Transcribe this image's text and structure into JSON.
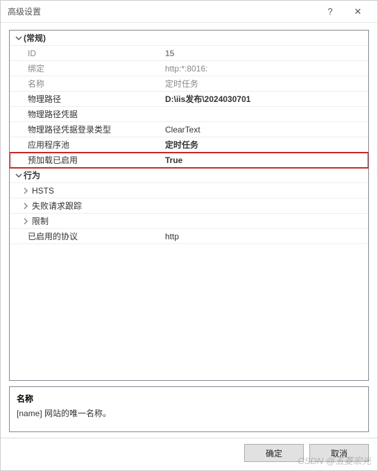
{
  "window": {
    "title": "高级设置",
    "help_icon": "?",
    "close_icon": "✕"
  },
  "sections": {
    "general": {
      "header": "(常规)",
      "rows": {
        "id": {
          "label": "ID",
          "value": "15"
        },
        "binding": {
          "label": "绑定",
          "value": "http:*:8016:"
        },
        "name": {
          "label": "名称",
          "value": "定时任务"
        },
        "physical_path": {
          "label": "物理路径",
          "value": "D:\\iis发布\\2024030701"
        },
        "physical_path_cred": {
          "label": "物理路径凭据",
          "value": ""
        },
        "physical_path_logon": {
          "label": "物理路径凭据登录类型",
          "value": "ClearText"
        },
        "app_pool": {
          "label": "应用程序池",
          "value": "定时任务"
        },
        "preload": {
          "label": "预加载已启用",
          "value": "True"
        }
      }
    },
    "behavior": {
      "header": "行为",
      "hsts": "HSTS",
      "failed_request": "失败请求跟踪",
      "limits": "限制",
      "protocols": {
        "label": "已启用的协议",
        "value": "http"
      }
    }
  },
  "description": {
    "title": "名称",
    "text": "[name] 网站的唯一名称。"
  },
  "buttons": {
    "ok": "确定",
    "cancel": "取消"
  },
  "watermark": "CSDN @五菱宏光"
}
